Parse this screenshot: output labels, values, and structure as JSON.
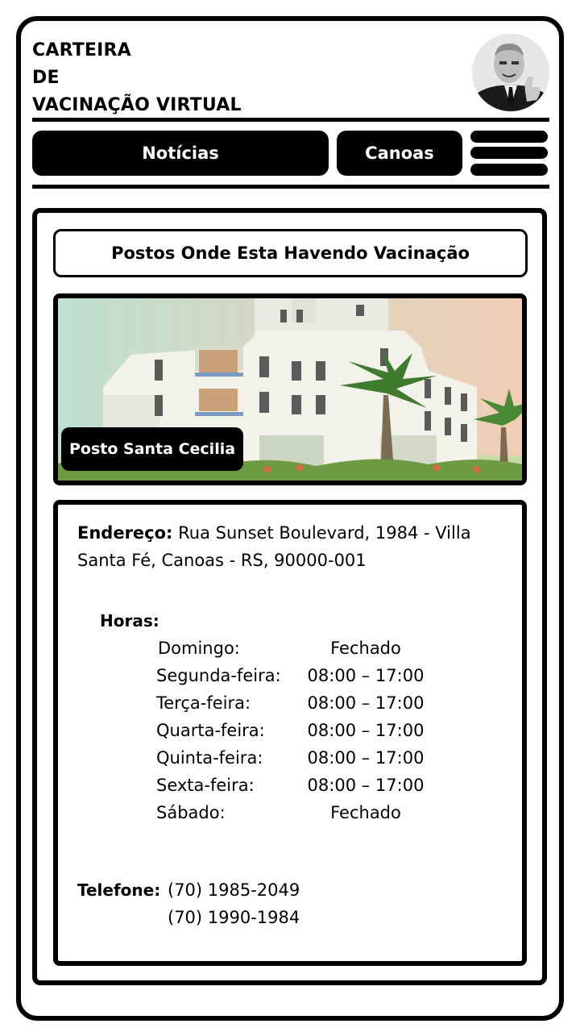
{
  "header": {
    "title_lines": [
      "CARTEIRA",
      "DE",
      "VACINAÇÃO VIRTUAL"
    ],
    "avatar_icon": "user-avatar"
  },
  "nav": {
    "news_label": "Notícias",
    "city_label": "Canoas",
    "menu_icon": "hamburger-menu-icon"
  },
  "section": {
    "title": "Postos Onde Esta Havendo Vacinação"
  },
  "post": {
    "name": "Posto Santa Cecilia",
    "address_label": "Endereço:",
    "address": " Rua Sunset Boulevard, 1984 - Villa Santa Fé, Canoas - RS, 90000-001",
    "hours_label": "Horas:",
    "hours": [
      {
        "day": "Domingo:",
        "time": "Fechado"
      },
      {
        "day": "Segunda-feira:",
        "time": "08:00 – 17:00"
      },
      {
        "day": "Terça-feira:",
        "time": "08:00 – 17:00"
      },
      {
        "day": "Quarta-feira:",
        "time": "08:00 – 17:00"
      },
      {
        "day": "Quinta-feira:",
        "time": "08:00 – 17:00"
      },
      {
        "day": "Sexta-feira:",
        "time": "08:00 – 17:00"
      },
      {
        "day": "Sábado:",
        "time": "Fechado"
      }
    ],
    "phone_label": "Telefone:",
    "phones": [
      "(70) 1985-2049",
      "(70) 1990-1984"
    ]
  }
}
